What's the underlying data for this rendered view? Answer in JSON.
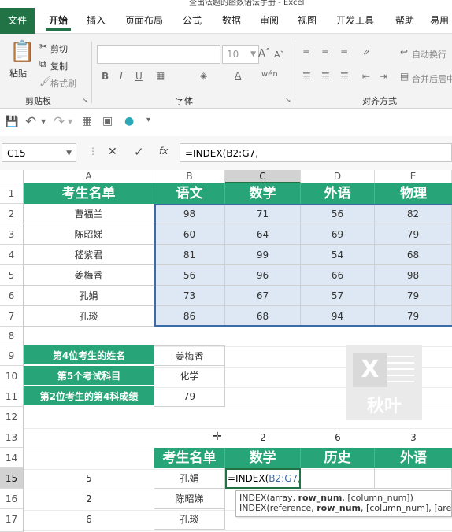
{
  "window": {
    "title": "查出法题的函数语法手册 - Excel"
  },
  "ribbon_tabs": [
    "文件",
    "开始",
    "插入",
    "页面布局",
    "公式",
    "数据",
    "审阅",
    "视图",
    "开发工具",
    "帮助",
    "易用"
  ],
  "clipboard": {
    "paste": "粘贴",
    "cut": "剪切",
    "copy": "复制",
    "format_painter": "格式刷",
    "group": "剪贴板"
  },
  "font": {
    "size": "10",
    "group": "字体"
  },
  "alignment": {
    "wrap": "自动换行",
    "merge": "合并后居中",
    "group": "对齐方式"
  },
  "formula_bar": {
    "name_box": "C15",
    "fx": "fx",
    "formula": "=INDEX(B2:G7,"
  },
  "columns": [
    "A",
    "B",
    "C",
    "D",
    "E"
  ],
  "rows": [
    "1",
    "2",
    "3",
    "4",
    "5",
    "6",
    "7",
    "8",
    "9",
    "10",
    "11",
    "12",
    "13",
    "14",
    "15",
    "16",
    "17"
  ],
  "table1": {
    "headers": [
      "考生名单",
      "语文",
      "数学",
      "外语",
      "物理"
    ],
    "rows": [
      [
        "曹福兰",
        "98",
        "71",
        "56",
        "82"
      ],
      [
        "陈昭娣",
        "60",
        "64",
        "69",
        "79"
      ],
      [
        "嵇紫君",
        "81",
        "99",
        "54",
        "68"
      ],
      [
        "姜梅香",
        "56",
        "96",
        "66",
        "98"
      ],
      [
        "孔娟",
        "73",
        "67",
        "57",
        "79"
      ],
      [
        "孔琰",
        "86",
        "68",
        "94",
        "79"
      ]
    ]
  },
  "lookup": {
    "rows": [
      {
        "label": "第4位考生的姓名",
        "value": "姜梅香"
      },
      {
        "label": "第5个考试科目",
        "value": "化学"
      },
      {
        "label": "第2位考生的第4科成绩",
        "value": "79"
      }
    ]
  },
  "row13": [
    "2",
    "6",
    "3"
  ],
  "table2": {
    "headers": [
      "考生名单",
      "数学",
      "历史",
      "外语"
    ],
    "left_numbers": [
      "5",
      "2",
      "6"
    ],
    "names": [
      "孔娟",
      "陈昭娣",
      "孔琰"
    ]
  },
  "edit_cell": {
    "prefix": "=INDEX(",
    "ref": "B2:G7",
    ",": ","
  },
  "tooltip": {
    "line1_a": "INDEX(array, ",
    "line1_b": "row_num",
    "line1_c": ", [column_num])",
    "line2_a": "INDEX(reference, ",
    "line2_b": "row_num",
    "line2_c": ", [column_num], [area_n"
  },
  "logo": {
    "text": "秋叶"
  },
  "colors": {
    "excel_green": "#217346",
    "header_green": "#27a579",
    "selection_blue": "#dde8f4"
  }
}
